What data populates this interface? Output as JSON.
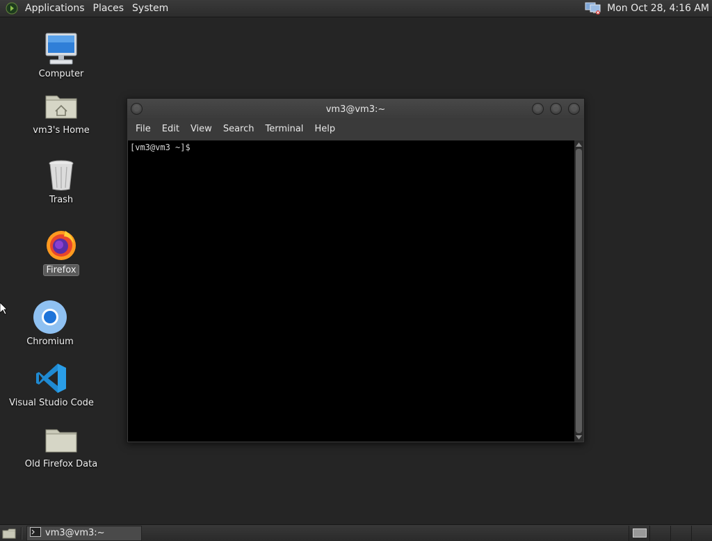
{
  "top_panel": {
    "menus": [
      "Applications",
      "Places",
      "System"
    ],
    "clock": "Mon Oct 28,  4:16 AM",
    "network_icon": "network-disconnected-icon"
  },
  "desktop": {
    "icons": [
      {
        "label": "Computer",
        "icon": "computer-icon"
      },
      {
        "label": "vm3's Home",
        "icon": "home-folder-icon"
      },
      {
        "label": "Trash",
        "icon": "trash-icon"
      },
      {
        "label": "Firefox",
        "icon": "firefox-icon",
        "selected": true
      },
      {
        "label": "Chromium",
        "icon": "chromium-icon"
      },
      {
        "label": "Visual Studio Code",
        "icon": "vscode-icon"
      },
      {
        "label": "Old Firefox Data",
        "icon": "folder-icon"
      }
    ]
  },
  "terminal": {
    "title": "vm3@vm3:~",
    "menu": [
      "File",
      "Edit",
      "View",
      "Search",
      "Terminal",
      "Help"
    ],
    "prompt": "[vm3@vm3 ~]$"
  },
  "bottom_panel": {
    "task_label": "vm3@vm3:~",
    "workspaces": 4,
    "active_workspace": 1
  },
  "colors": {
    "desktop_bg": "#252525",
    "panel_bg": "#333333",
    "terminal_bg": "#000000"
  }
}
